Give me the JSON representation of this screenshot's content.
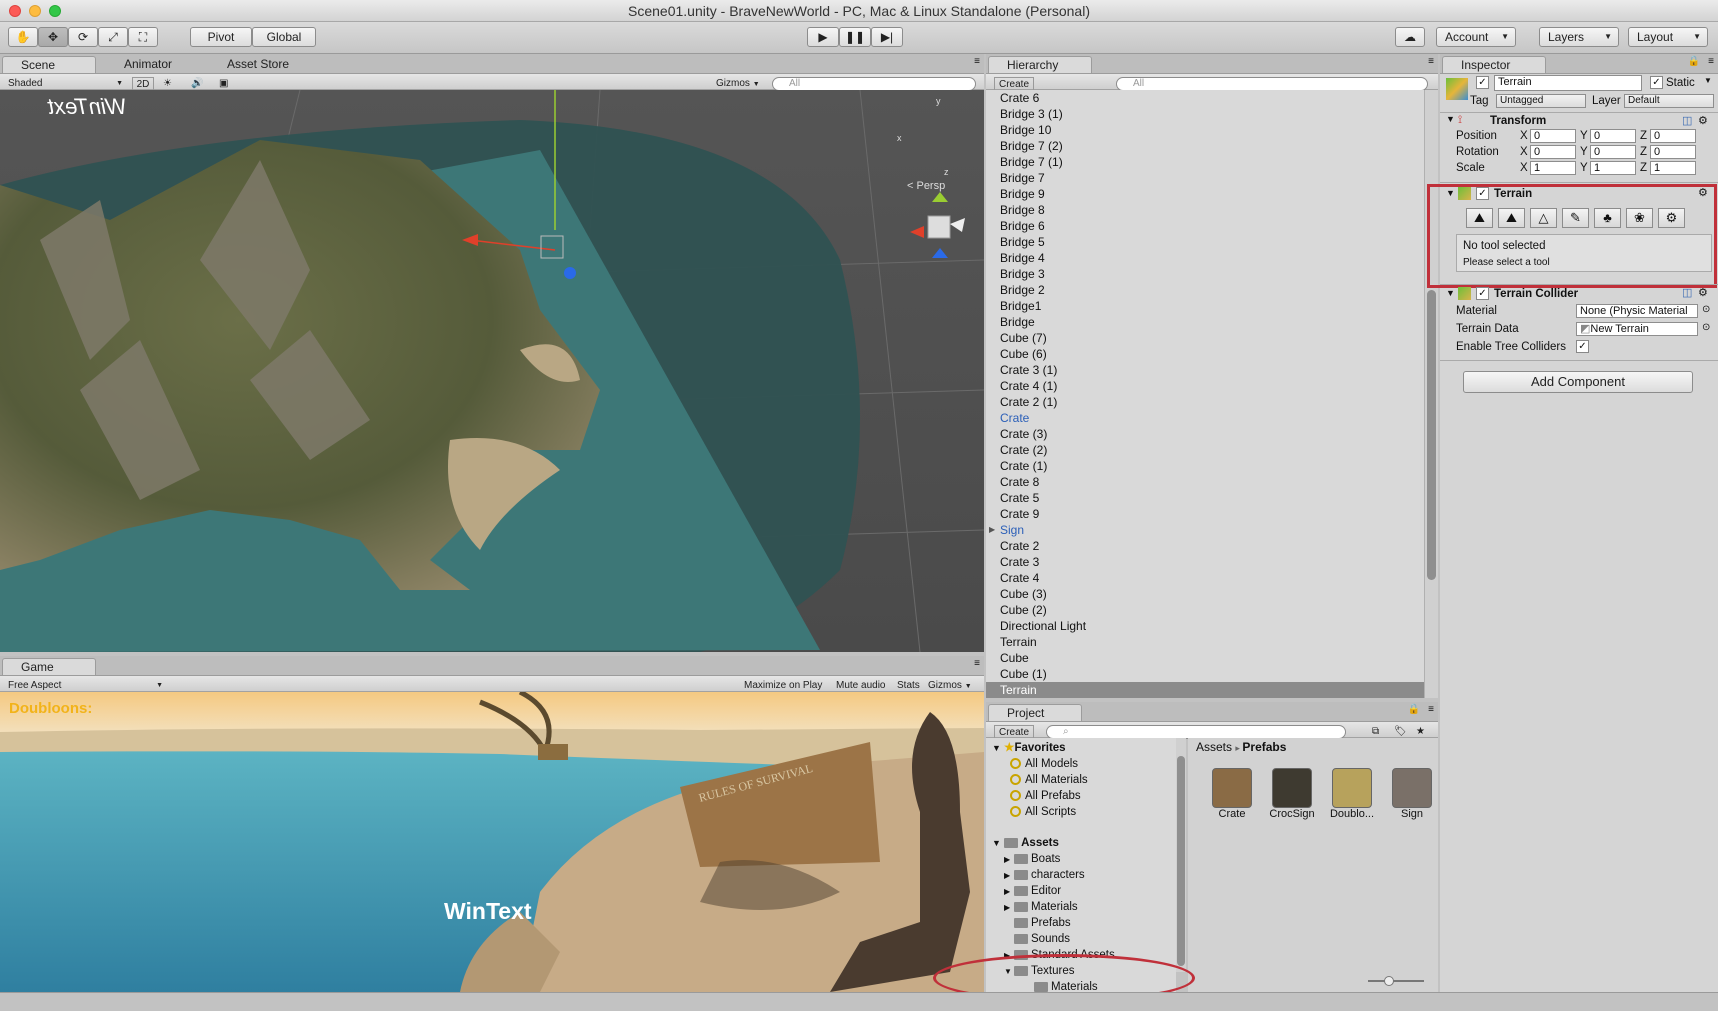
{
  "window": {
    "title": "Scene01.unity - BraveNewWorld - PC, Mac & Linux Standalone (Personal)"
  },
  "toolbar": {
    "pivot_label": "Pivot",
    "global_label": "Global",
    "account_label": "Account",
    "layers_label": "Layers",
    "layout_label": "Layout"
  },
  "scene": {
    "tabs": [
      "Scene",
      "Animator",
      "Asset Store"
    ],
    "shading": "Shaded",
    "mode_2d": "2D",
    "gizmos": "Gizmos",
    "search_placeholder": "All",
    "overlay_text": "WinText",
    "persp_label": "< Persp",
    "axis_x": "x",
    "axis_y": "y",
    "axis_z": "z"
  },
  "game": {
    "tab": "Game",
    "aspect": "Free Aspect",
    "maximize": "Maximize on Play",
    "mute": "Mute audio",
    "stats": "Stats",
    "gizmos": "Gizmos",
    "doubloons": "Doubloons:",
    "wintext": "WinText"
  },
  "hierarchy": {
    "tab": "Hierarchy",
    "create": "Create",
    "search_placeholder": "All",
    "items": [
      "Crate 6",
      "Bridge 3 (1)",
      "Bridge 10",
      "Bridge 7 (2)",
      "Bridge 7 (1)",
      "Bridge 7",
      "Bridge 9",
      "Bridge 8",
      "Bridge 6",
      "Bridge 5",
      "Bridge 4",
      "Bridge 3",
      "Bridge 2",
      "Bridge1",
      "Bridge",
      "Cube (7)",
      "Cube (6)",
      "Crate 3 (1)",
      "Crate 4 (1)",
      "Crate 2 (1)",
      "Crate",
      "Crate (3)",
      "Crate (2)",
      "Crate (1)",
      "Crate 8",
      "Crate 5",
      "Crate 9",
      "Sign",
      "Crate 2",
      "Crate 3",
      "Crate 4",
      "Cube (3)",
      "Cube (2)",
      "Directional Light",
      "Terrain",
      "Cube",
      "Cube (1)",
      "Terrain"
    ]
  },
  "project": {
    "tab": "Project",
    "create": "Create",
    "favorites_label": "Favorites",
    "favorites": [
      "All Models",
      "All Materials",
      "All Prefabs",
      "All Scripts"
    ],
    "assets_label": "Assets",
    "folders": [
      "Boats",
      "characters",
      "Editor",
      "Materials",
      "Prefabs",
      "Sounds",
      "Standard Assets",
      "Textures",
      "Materials"
    ],
    "breadcrumb": [
      "Assets",
      "Prefabs"
    ],
    "prefabs": [
      "Crate",
      "CrocSign",
      "Doublo...",
      "Sign"
    ]
  },
  "inspector": {
    "tab": "Inspector",
    "object_name": "Terrain",
    "static_label": "Static",
    "tag_label": "Tag",
    "tag_value": "Untagged",
    "layer_label": "Layer",
    "layer_value": "Default",
    "transform": {
      "title": "Transform",
      "rows": [
        {
          "label": "Position",
          "x": "0",
          "y": "0",
          "z": "0"
        },
        {
          "label": "Rotation",
          "x": "0",
          "y": "0",
          "z": "0"
        },
        {
          "label": "Scale",
          "x": "1",
          "y": "1",
          "z": "1"
        }
      ]
    },
    "terrain": {
      "title": "Terrain",
      "status": "No tool selected",
      "hint": "Please select a tool"
    },
    "collider": {
      "title": "Terrain Collider",
      "material_label": "Material",
      "material_value": "None (Physic Material",
      "data_label": "Terrain Data",
      "data_value": "New Terrain",
      "trees_label": "Enable Tree Colliders"
    },
    "add_component": "Add Component"
  },
  "colors": {
    "highlight_red": "#c0303a",
    "selection_blue": "#2b5fb8",
    "water": "#3d7777"
  }
}
